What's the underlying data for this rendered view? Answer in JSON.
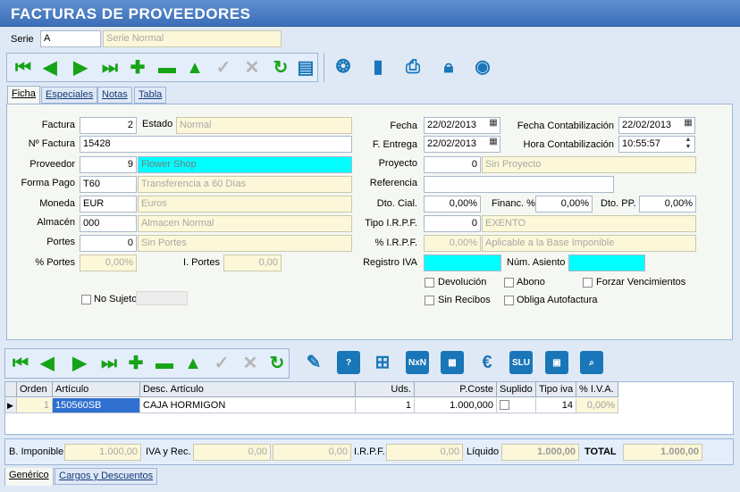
{
  "window": {
    "title": "FACTURAS DE PROVEEDORES"
  },
  "serie": {
    "label": "Serie",
    "value": "A",
    "description": "Serie Normal"
  },
  "tabs": [
    "Ficha",
    "Especiales",
    "Notas",
    "Tabla"
  ],
  "form": {
    "factura": {
      "label": "Factura",
      "value": "2"
    },
    "estado": {
      "label": "Estado",
      "value": "Normal"
    },
    "num_factura": {
      "label": "Nº Factura",
      "value": "15428"
    },
    "proveedor": {
      "label": "Proveedor",
      "value": "9",
      "name": "Flower Shop"
    },
    "forma_pago": {
      "label": "Forma Pago",
      "value": "T60",
      "description": "Transferencia a 60 Días"
    },
    "moneda": {
      "label": "Moneda",
      "value": "EUR",
      "description": "Euros"
    },
    "almacen": {
      "label": "Almacén",
      "value": "000",
      "description": "Almacen Normal"
    },
    "portes": {
      "label": "Portes",
      "value": "0",
      "description": "Sin Portes"
    },
    "pct_portes": {
      "label": "% Portes",
      "value": "0,00%"
    },
    "i_portes": {
      "label": "I. Portes",
      "value": "0,00"
    },
    "no_sujeto": {
      "label": "No Sujeto"
    },
    "fecha": {
      "label": "Fecha",
      "value": "22/02/2013"
    },
    "fecha_contab": {
      "label": "Fecha Contabilización",
      "value": "22/02/2013"
    },
    "f_entrega": {
      "label": "F. Entrega",
      "value": "22/02/2013"
    },
    "hora_contab": {
      "label": "Hora Contabilización",
      "value": "10:55:57"
    },
    "proyecto": {
      "label": "Proyecto",
      "value": "0",
      "description": "Sin Proyecto"
    },
    "referencia": {
      "label": "Referencia",
      "value": ""
    },
    "dto_cial": {
      "label": "Dto. Cial.",
      "value": "0,00%"
    },
    "financ": {
      "label": "Financ. %",
      "value": "0,00%"
    },
    "dto_pp": {
      "label": "Dto. PP.",
      "value": "0,00%"
    },
    "tipo_irpf": {
      "label": "Tipo I.R.P.F.",
      "value": "0",
      "description": "EXENTO"
    },
    "pct_irpf": {
      "label": "% I.R.P.F.",
      "value": "0,00%",
      "description": "Aplicable a la Base Imponible"
    },
    "registro_iva": {
      "label": "Registro IVA",
      "value": ""
    },
    "num_asiento": {
      "label": "Núm. Asiento",
      "value": ""
    },
    "devolucion": {
      "label": "Devolución"
    },
    "abono": {
      "label": "Abono"
    },
    "forzar_venc": {
      "label": "Forzar Vencimientos"
    },
    "sin_recibos": {
      "label": "Sin Recibos"
    },
    "obliga_autofactura": {
      "label": "Obliga Autofactura"
    }
  },
  "grid": {
    "columns": [
      "Orden",
      "Artículo",
      "Desc. Artículo",
      "Uds.",
      "P.Coste",
      "Suplido",
      "Tipo iva",
      "% I.V.A."
    ],
    "rows": [
      {
        "orden": "1",
        "articulo": "150560SB",
        "desc": "CAJA HORMIGON",
        "uds": "1",
        "pcoste": "1.000,000",
        "tipo_iva": "14",
        "pct_iva": "0,00%"
      }
    ]
  },
  "totals": {
    "base_label": "B. Imponible",
    "base": "1.000,00",
    "iva_label": "IVA y Rec.",
    "iva": "0,00",
    "rec": "0,00",
    "irpf_label": "I.R.P.F.",
    "irpf": "0,00",
    "liquido_label": "Líquido",
    "liquido": "1.000,00",
    "total_label": "TOTAL",
    "total": "1.000,00"
  },
  "bottom_tabs": [
    "Genérico",
    "Cargos y Descuentos"
  ],
  "icons": {
    "first": "◀",
    "prev": "◀",
    "next": "▶",
    "last": "▶",
    "add": "+",
    "delete": "−",
    "up": "▲",
    "confirm": "✓",
    "cancel": "✕",
    "refresh": "↻"
  }
}
